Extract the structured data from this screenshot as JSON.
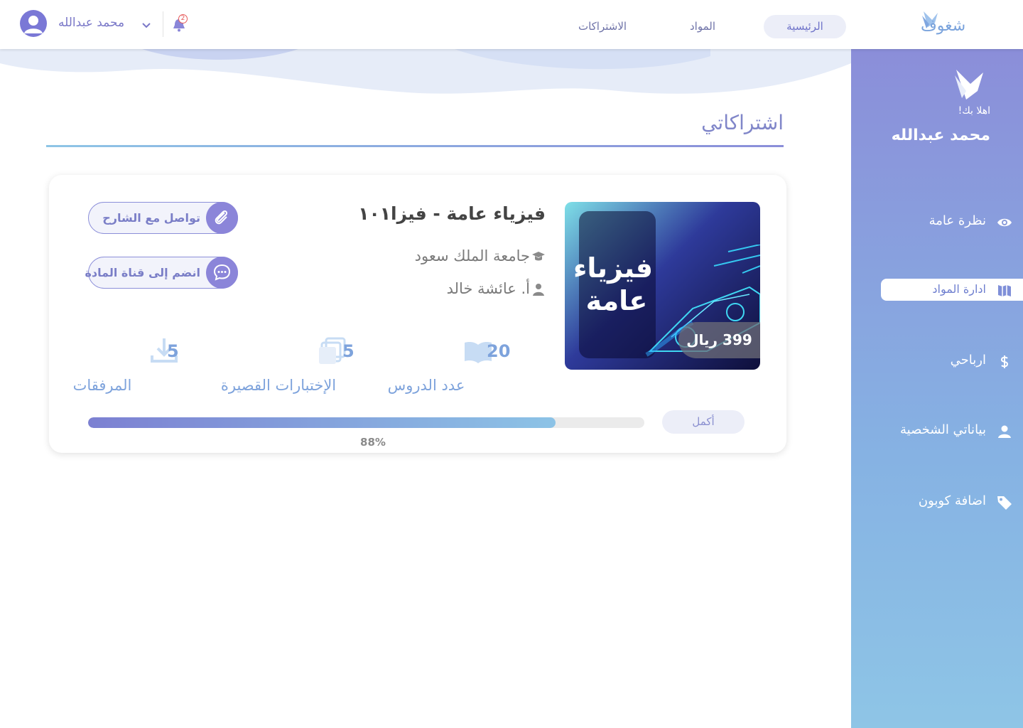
{
  "brand": {
    "name": "شغوف"
  },
  "nav": {
    "items": [
      {
        "label": "الرئيسية",
        "active": true
      },
      {
        "label": "المواد",
        "active": false
      },
      {
        "label": "الاشتراكات",
        "active": false
      }
    ]
  },
  "user": {
    "name": "محمد عبدالله",
    "notifications_count": "2"
  },
  "sidebar": {
    "welcome": "اهلا بك!",
    "name": "محمد عبدالله",
    "items": [
      {
        "label": "نظرة عامة",
        "icon": "eye-icon"
      },
      {
        "label": "ادارة المواد",
        "icon": "book-map-icon",
        "active": true
      },
      {
        "label": "ارباحي",
        "icon": "dollar-icon"
      },
      {
        "label": "بياناتي الشخصية",
        "icon": "user-icon"
      },
      {
        "label": "اضافة كوبون",
        "icon": "tag-icon"
      }
    ]
  },
  "page": {
    "title": "اشتراكاتي"
  },
  "course": {
    "title": "فيزياء عامة - فيزا١٠١",
    "thumb_text_line1": "فيزياء",
    "thumb_text_line2": "عامة",
    "price": "399 ريال",
    "university": "جامعة الملك سعود",
    "teacher": "أ. عائشة خالد",
    "contact_label": "تواصل مع الشارح",
    "channel_label": "انضم إلى قناة المادة",
    "stats": {
      "lessons": {
        "value": "20",
        "label": "عدد الدروس"
      },
      "quizzes": {
        "value": "5",
        "label": "الإختبارات القصيرة"
      },
      "attachments": {
        "value": "5",
        "label": "المرفقات"
      }
    },
    "complete_label": "أكمل",
    "progress_label": "88%",
    "progress_value": 0.84
  },
  "colors": {
    "accent": "#8b8ed9",
    "accent_light": "#8ec5e6",
    "text_muted": "#7a7a7a"
  }
}
